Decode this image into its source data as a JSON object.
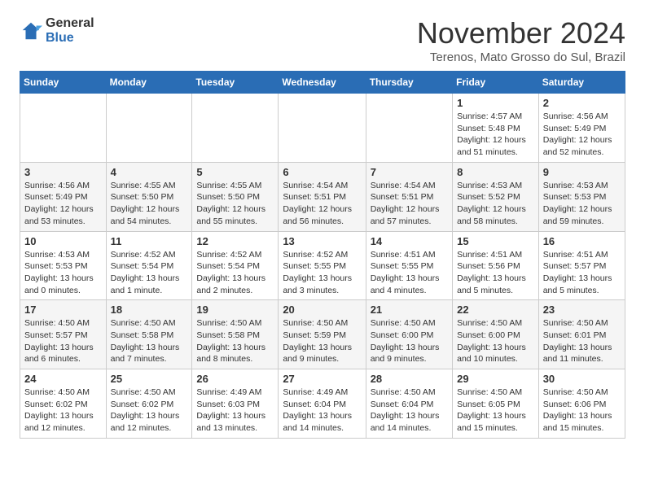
{
  "logo": {
    "general": "General",
    "blue": "Blue"
  },
  "header": {
    "month_year": "November 2024",
    "location": "Terenos, Mato Grosso do Sul, Brazil"
  },
  "weekdays": [
    "Sunday",
    "Monday",
    "Tuesday",
    "Wednesday",
    "Thursday",
    "Friday",
    "Saturday"
  ],
  "weeks": [
    [
      {
        "day": "",
        "sunrise": "",
        "sunset": "",
        "daylight": ""
      },
      {
        "day": "",
        "sunrise": "",
        "sunset": "",
        "daylight": ""
      },
      {
        "day": "",
        "sunrise": "",
        "sunset": "",
        "daylight": ""
      },
      {
        "day": "",
        "sunrise": "",
        "sunset": "",
        "daylight": ""
      },
      {
        "day": "",
        "sunrise": "",
        "sunset": "",
        "daylight": ""
      },
      {
        "day": "1",
        "sunrise": "Sunrise: 4:57 AM",
        "sunset": "Sunset: 5:48 PM",
        "daylight": "Daylight: 12 hours and 51 minutes."
      },
      {
        "day": "2",
        "sunrise": "Sunrise: 4:56 AM",
        "sunset": "Sunset: 5:49 PM",
        "daylight": "Daylight: 12 hours and 52 minutes."
      }
    ],
    [
      {
        "day": "3",
        "sunrise": "Sunrise: 4:56 AM",
        "sunset": "Sunset: 5:49 PM",
        "daylight": "Daylight: 12 hours and 53 minutes."
      },
      {
        "day": "4",
        "sunrise": "Sunrise: 4:55 AM",
        "sunset": "Sunset: 5:50 PM",
        "daylight": "Daylight: 12 hours and 54 minutes."
      },
      {
        "day": "5",
        "sunrise": "Sunrise: 4:55 AM",
        "sunset": "Sunset: 5:50 PM",
        "daylight": "Daylight: 12 hours and 55 minutes."
      },
      {
        "day": "6",
        "sunrise": "Sunrise: 4:54 AM",
        "sunset": "Sunset: 5:51 PM",
        "daylight": "Daylight: 12 hours and 56 minutes."
      },
      {
        "day": "7",
        "sunrise": "Sunrise: 4:54 AM",
        "sunset": "Sunset: 5:51 PM",
        "daylight": "Daylight: 12 hours and 57 minutes."
      },
      {
        "day": "8",
        "sunrise": "Sunrise: 4:53 AM",
        "sunset": "Sunset: 5:52 PM",
        "daylight": "Daylight: 12 hours and 58 minutes."
      },
      {
        "day": "9",
        "sunrise": "Sunrise: 4:53 AM",
        "sunset": "Sunset: 5:53 PM",
        "daylight": "Daylight: 12 hours and 59 minutes."
      }
    ],
    [
      {
        "day": "10",
        "sunrise": "Sunrise: 4:53 AM",
        "sunset": "Sunset: 5:53 PM",
        "daylight": "Daylight: 13 hours and 0 minutes."
      },
      {
        "day": "11",
        "sunrise": "Sunrise: 4:52 AM",
        "sunset": "Sunset: 5:54 PM",
        "daylight": "Daylight: 13 hours and 1 minute."
      },
      {
        "day": "12",
        "sunrise": "Sunrise: 4:52 AM",
        "sunset": "Sunset: 5:54 PM",
        "daylight": "Daylight: 13 hours and 2 minutes."
      },
      {
        "day": "13",
        "sunrise": "Sunrise: 4:52 AM",
        "sunset": "Sunset: 5:55 PM",
        "daylight": "Daylight: 13 hours and 3 minutes."
      },
      {
        "day": "14",
        "sunrise": "Sunrise: 4:51 AM",
        "sunset": "Sunset: 5:55 PM",
        "daylight": "Daylight: 13 hours and 4 minutes."
      },
      {
        "day": "15",
        "sunrise": "Sunrise: 4:51 AM",
        "sunset": "Sunset: 5:56 PM",
        "daylight": "Daylight: 13 hours and 5 minutes."
      },
      {
        "day": "16",
        "sunrise": "Sunrise: 4:51 AM",
        "sunset": "Sunset: 5:57 PM",
        "daylight": "Daylight: 13 hours and 5 minutes."
      }
    ],
    [
      {
        "day": "17",
        "sunrise": "Sunrise: 4:50 AM",
        "sunset": "Sunset: 5:57 PM",
        "daylight": "Daylight: 13 hours and 6 minutes."
      },
      {
        "day": "18",
        "sunrise": "Sunrise: 4:50 AM",
        "sunset": "Sunset: 5:58 PM",
        "daylight": "Daylight: 13 hours and 7 minutes."
      },
      {
        "day": "19",
        "sunrise": "Sunrise: 4:50 AM",
        "sunset": "Sunset: 5:58 PM",
        "daylight": "Daylight: 13 hours and 8 minutes."
      },
      {
        "day": "20",
        "sunrise": "Sunrise: 4:50 AM",
        "sunset": "Sunset: 5:59 PM",
        "daylight": "Daylight: 13 hours and 9 minutes."
      },
      {
        "day": "21",
        "sunrise": "Sunrise: 4:50 AM",
        "sunset": "Sunset: 6:00 PM",
        "daylight": "Daylight: 13 hours and 9 minutes."
      },
      {
        "day": "22",
        "sunrise": "Sunrise: 4:50 AM",
        "sunset": "Sunset: 6:00 PM",
        "daylight": "Daylight: 13 hours and 10 minutes."
      },
      {
        "day": "23",
        "sunrise": "Sunrise: 4:50 AM",
        "sunset": "Sunset: 6:01 PM",
        "daylight": "Daylight: 13 hours and 11 minutes."
      }
    ],
    [
      {
        "day": "24",
        "sunrise": "Sunrise: 4:50 AM",
        "sunset": "Sunset: 6:02 PM",
        "daylight": "Daylight: 13 hours and 12 minutes."
      },
      {
        "day": "25",
        "sunrise": "Sunrise: 4:50 AM",
        "sunset": "Sunset: 6:02 PM",
        "daylight": "Daylight: 13 hours and 12 minutes."
      },
      {
        "day": "26",
        "sunrise": "Sunrise: 4:49 AM",
        "sunset": "Sunset: 6:03 PM",
        "daylight": "Daylight: 13 hours and 13 minutes."
      },
      {
        "day": "27",
        "sunrise": "Sunrise: 4:49 AM",
        "sunset": "Sunset: 6:04 PM",
        "daylight": "Daylight: 13 hours and 14 minutes."
      },
      {
        "day": "28",
        "sunrise": "Sunrise: 4:50 AM",
        "sunset": "Sunset: 6:04 PM",
        "daylight": "Daylight: 13 hours and 14 minutes."
      },
      {
        "day": "29",
        "sunrise": "Sunrise: 4:50 AM",
        "sunset": "Sunset: 6:05 PM",
        "daylight": "Daylight: 13 hours and 15 minutes."
      },
      {
        "day": "30",
        "sunrise": "Sunrise: 4:50 AM",
        "sunset": "Sunset: 6:06 PM",
        "daylight": "Daylight: 13 hours and 15 minutes."
      }
    ]
  ]
}
